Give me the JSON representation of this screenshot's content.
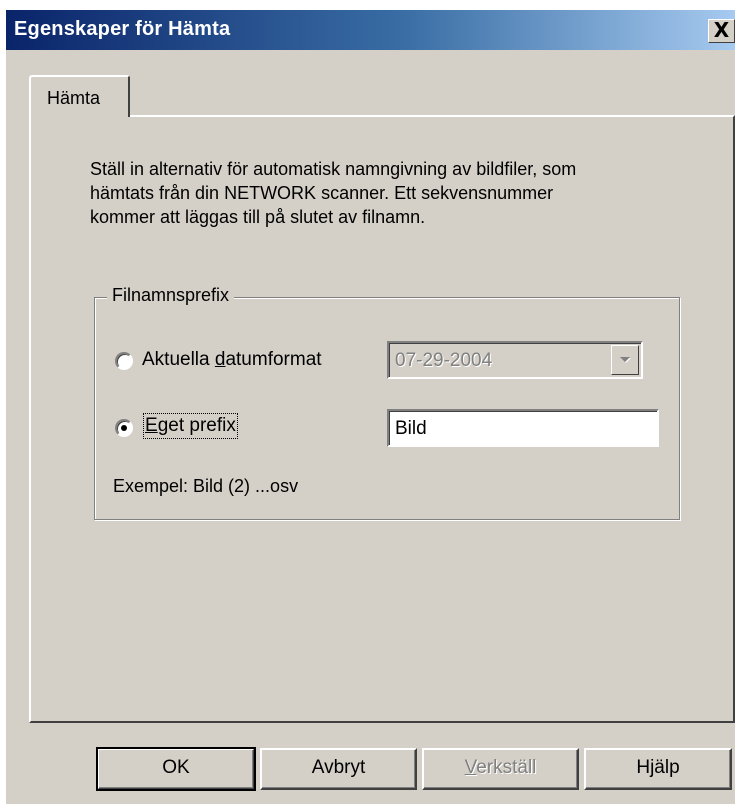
{
  "window": {
    "title": "Egenskaper för Hämta",
    "close_label": "X"
  },
  "tabs": [
    {
      "label": "Hämta",
      "selected": true
    }
  ],
  "description": {
    "lines": [
      "Ställ in alternativ för automatisk namngivning av bildfiler, som",
      "hämtats från din NETWORK scanner. Ett sekvensnummer",
      "kommer att läggas till på slutet av filnamn."
    ]
  },
  "prefix_group": {
    "legend": "Filnamnsprefix",
    "option_date": {
      "label_pre": "Aktuella ",
      "label_key": "d",
      "label_post": "atumformat",
      "selected": false
    },
    "date_combo": {
      "value": "07-29-2004",
      "enabled": false
    },
    "option_custom": {
      "label_key": "E",
      "label_post": "get prefix",
      "selected": true
    },
    "custom_input": {
      "value": "Bild"
    },
    "example_text": "Exempel: Bild (2) ...osv"
  },
  "buttons": {
    "ok": "OK",
    "cancel": "Avbryt",
    "apply_key": "V",
    "apply_post": "erkställ",
    "apply_enabled": false,
    "help": "Hjälp"
  },
  "colors": {
    "dialog_face": "#d4d0c8",
    "title_start": "#0a246a",
    "title_end": "#a6caf0",
    "disabled_text": "#808080"
  }
}
